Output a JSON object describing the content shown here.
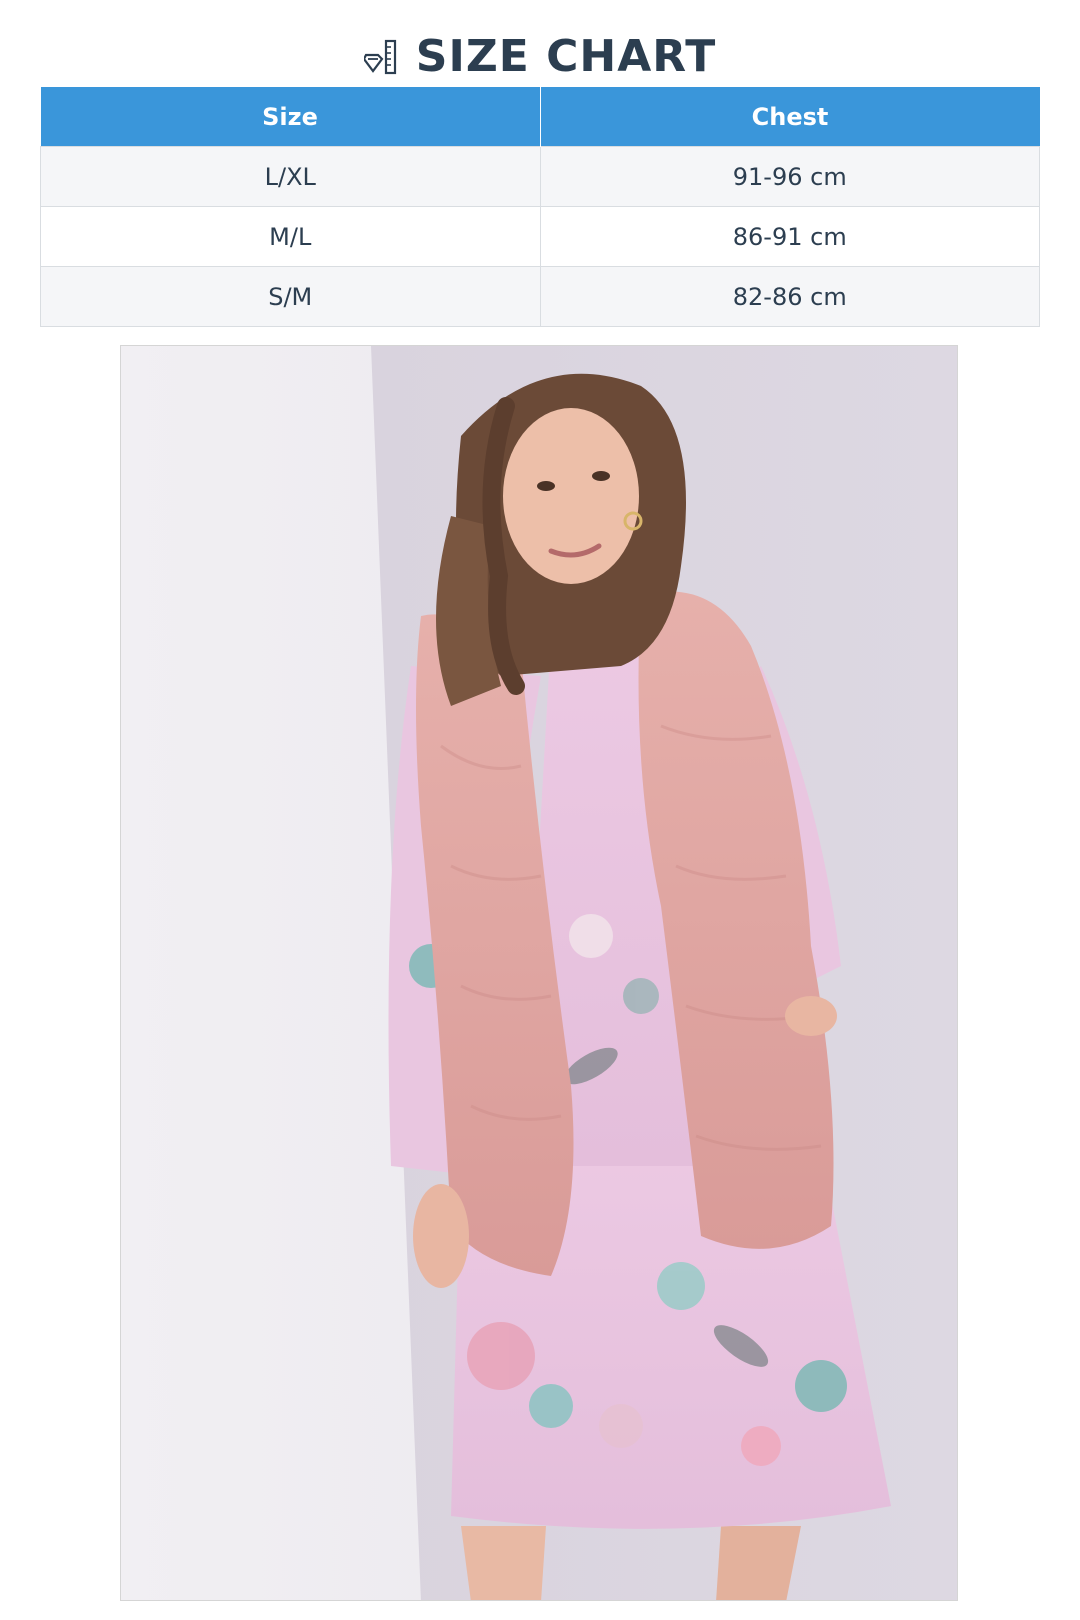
{
  "header": {
    "title": "SIZE CHART",
    "icon": "ruler-icon"
  },
  "size_table": {
    "columns": [
      "Size",
      "Chest"
    ],
    "rows": [
      {
        "size": "L/XL",
        "chest": "91-96 cm"
      },
      {
        "size": "M/L",
        "chest": "86-91 cm"
      },
      {
        "size": "S/M",
        "chest": "82-86 cm"
      }
    ]
  },
  "colors": {
    "header_bg": "#3a96da",
    "title_text": "#2c3e50",
    "vest": "#e2a6a3",
    "dress": "#e7c4df"
  },
  "photo": {
    "subject": "product-photo"
  }
}
